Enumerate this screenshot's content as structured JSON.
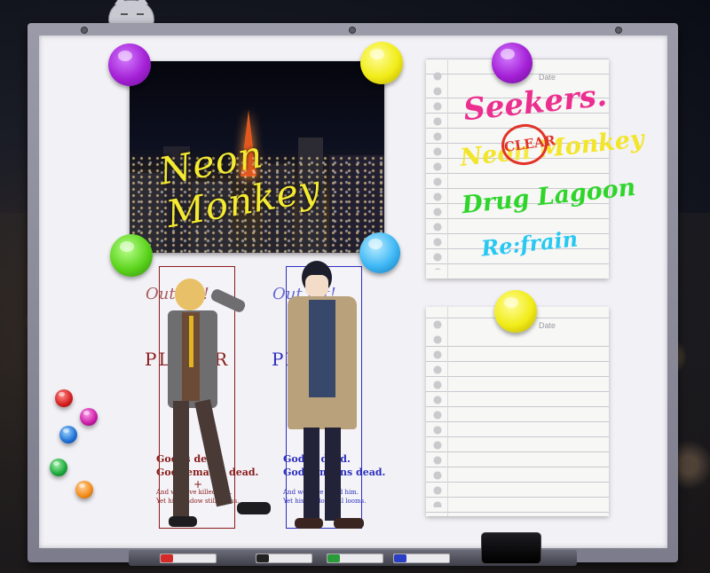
{
  "photo": {
    "title": "Neon Monkey"
  },
  "posters": [
    {
      "subtitle": "Out tat!",
      "big": "PLAYER",
      "line1": "God is dead.",
      "line2": "God remains dead.",
      "plus": "+",
      "line3": "And we have killed him.",
      "line4": "Yet his shadow still looms.",
      "color": "#8a1c1c"
    },
    {
      "subtitle": "Out tat!",
      "big": "PLAYER",
      "line1": "God is dead.",
      "line2": "God remains dead.",
      "plus": "",
      "line3": "And we have killed him.",
      "line4": "Yet his shadow still looms.",
      "color": "#2b2fbf"
    }
  ],
  "note_top": {
    "date_label": "Date",
    "entries": [
      {
        "text": "Seekers.",
        "color": "#ec2f8f"
      },
      {
        "text": "Neon Monkey",
        "color": "#f3e529"
      },
      {
        "text": "Drug Lagoon",
        "color": "#2fd52b"
      },
      {
        "text": "Re:frain",
        "color": "#29c8f2"
      }
    ],
    "stamp": "CLEAR"
  },
  "note_bottom": {
    "date_label": "Date"
  },
  "magnets": {
    "purple": "#a421d6",
    "yellow": "#f1ec18",
    "green": "#5cd41d",
    "blue": "#3fb8f5",
    "red": "#d41b1b",
    "magenta": "#c81aa6",
    "orange": "#f28a17"
  },
  "markers": [
    {
      "name": "red-marker",
      "color": "#d62a2a"
    },
    {
      "name": "black-marker",
      "color": "#222222"
    },
    {
      "name": "green-marker",
      "color": "#2a9a3a"
    },
    {
      "name": "blue-marker",
      "color": "#2a3fc4"
    }
  ]
}
